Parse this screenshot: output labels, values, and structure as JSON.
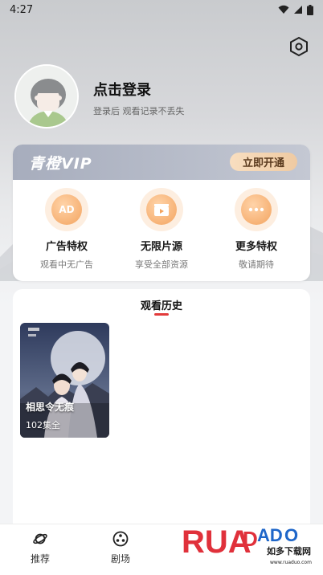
{
  "status_bar": {
    "time": "4:27"
  },
  "profile": {
    "login_title": "点击登录",
    "login_subtitle": "登录后 观看记录不丢失"
  },
  "vip": {
    "brand": "青橙VIP",
    "open_button": "立即开通",
    "perks": [
      {
        "icon": "ad-icon",
        "icon_text": "AD",
        "title": "广告特权",
        "desc": "观看中无广告"
      },
      {
        "icon": "film-icon",
        "title": "无限片源",
        "desc": "享受全部资源"
      },
      {
        "icon": "more-icon",
        "title": "更多特权",
        "desc": "敬请期待"
      }
    ]
  },
  "history": {
    "title": "观看历史",
    "items": [
      {
        "poster_title": "相思令无痕",
        "episodes": "102集全"
      }
    ]
  },
  "tabbar": {
    "items": [
      {
        "icon": "planet-icon",
        "label": "推荐"
      },
      {
        "icon": "film-reel-icon",
        "label": "剧场"
      }
    ]
  },
  "watermark": {
    "brand": "RUADADO",
    "sub": "如多下载网",
    "url": "www.ruaduo.com"
  },
  "colors": {
    "accent_red": "#e23b3b",
    "perk_orange": "#f3a460",
    "vip_gold": "#efcaa2"
  }
}
